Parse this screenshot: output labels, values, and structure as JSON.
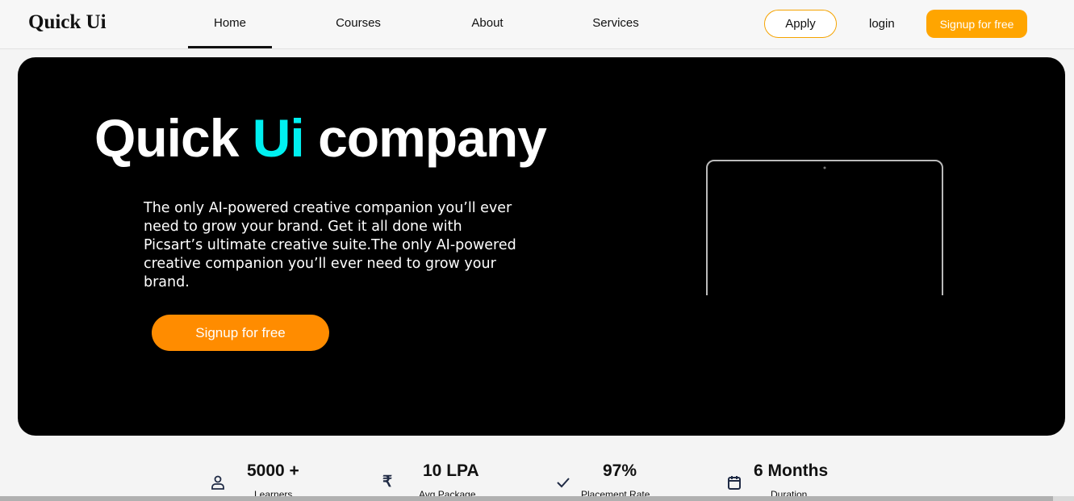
{
  "nav": {
    "logo": "Quick Ui",
    "links": [
      "Home",
      "Courses",
      "About",
      "Services"
    ],
    "apply": "Apply",
    "login": "login",
    "signup": "Signup for free"
  },
  "hero": {
    "title_a": "Quick ",
    "title_accent": "Ui",
    "title_b": " company",
    "description": "The only AI-powered creative companion you’ll ever need to grow your brand. Get it all done with Picsart’s ultimate creative suite.The only AI-powered creative companion you’ll ever need to grow your brand.",
    "cta": "Signup for free",
    "accent_color": "#00f0f0",
    "cta_color": "#ff8c00"
  },
  "stats": [
    {
      "value": "5000 +",
      "label": "Learners",
      "icon": "user-icon"
    },
    {
      "value": "10 LPA",
      "label": "Avg Package",
      "icon": "rupee-icon"
    },
    {
      "value": "97%",
      "label": "Placement Rate",
      "icon": "check-icon"
    },
    {
      "value": "6 Months",
      "label": "Duration",
      "icon": "calendar-icon"
    }
  ]
}
